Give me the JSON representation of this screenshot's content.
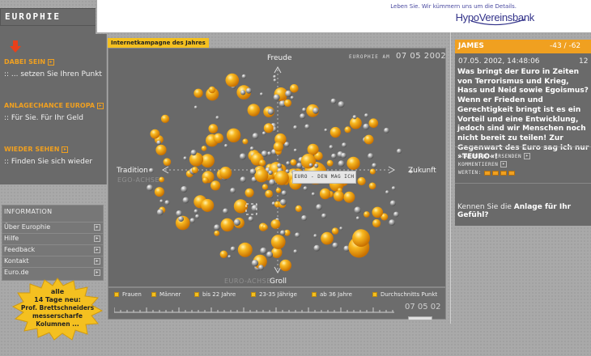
{
  "brand": {
    "slogan": "Leben Sie. Wir kümmern uns um die Details.",
    "name": "HypoVereinsbank"
  },
  "logo": "EUROPHIE",
  "nav": [
    {
      "title": "DABEI SEIN",
      "sub": ":: ... setzen Sie Ihren Punkt"
    },
    {
      "title": "ANLAGECHANCE EUROPA",
      "sub": ":: Für Sie. Für Ihr Geld"
    },
    {
      "title": "WIEDER SEHEN",
      "sub": ":: Finden Sie sich wieder"
    }
  ],
  "info": {
    "title": "INFORMATION",
    "items": [
      "Über Europhie",
      "Hilfe",
      "Feedback",
      "Kontakt",
      "Euro.de"
    ]
  },
  "promo": {
    "line1": "alle",
    "line2": "14 Tage neu:",
    "line3": "Prof. Brettschneiders",
    "line4": "messerscharfe",
    "line5": "Kolumnen ..."
  },
  "main": {
    "tab": "Internetkampagne des Jahres",
    "date_small": "EUROPHIE AM",
    "date": "07 05 2002",
    "axis_top": "Freude",
    "axis_bottom": "Groll",
    "axis_bottom_dim": "EURO-ACHSE",
    "axis_left": "Tradition",
    "axis_left_dim": "EGO-ACHSE",
    "axis_right": "Zukunft",
    "center_label": "EURO - DEN MAG ICH"
  },
  "filters": [
    "Frauen",
    "Männer",
    "bis 22 Jahre",
    "23-35 Jährige",
    "ab 36 Jahre",
    "Durchschnitts Punkt"
  ],
  "timeline_date": "07 05 02",
  "statement": {
    "name": "JAMES",
    "score": "-43 / -62",
    "datetime": "07.05. 2002, 14:48:06",
    "num": "12",
    "text": "Was bringt der Euro in Zeiten von Terrorismus und Krieg, Hass und Neid sowie Egoismus? Wenn er Frieden und Gerechtigkeit bringt ist es ein Vorteil und eine Entwicklung, jedoch sind wir Menschen noch nicht bereit zu teilen! Zur Gegenwart des Euro sag ich nur »TEURO«!",
    "action_send": "STATEMENT VERSENDEN",
    "action_comment": "KOMMENTIEREN",
    "action_rate": "WERTEN:",
    "feel_prefix": "Kennen Sie die",
    "feel_bold": "Anlage für Ihr Gefühl?"
  },
  "colors": {
    "accent": "#f0a020",
    "panel": "#6a6a6a",
    "viz_bg": "#696969",
    "tab_yellow": "#f4c020",
    "brand_blue": "#33338a"
  }
}
